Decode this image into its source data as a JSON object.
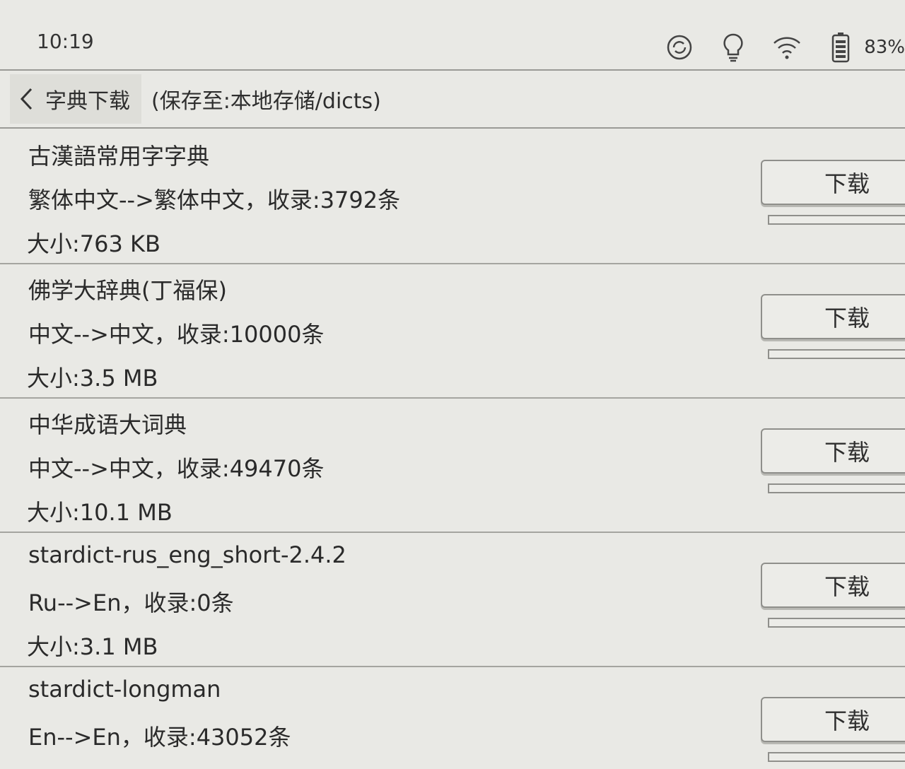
{
  "status_bar": {
    "time": "10:19",
    "battery": "83%"
  },
  "header": {
    "title": "字典下载",
    "subtitle": "(保存至:本地存储/dicts)"
  },
  "download_label": "下载",
  "dictionaries": [
    {
      "name": "古漢語常用字字典",
      "desc": "繁体中文-->繁体中文，收录:3792条",
      "size": "大小:763 KB",
      "button": "下载",
      "progress": 0
    },
    {
      "name": "佛学大辞典(丁福保)",
      "desc": "中文-->中文，收录:10000条",
      "size": "大小:3.5 MB",
      "button": "下载",
      "progress": 0
    },
    {
      "name": "中华成语大词典",
      "desc": "中文-->中文，收录:49470条",
      "size": "大小:10.1 MB",
      "button": "下载",
      "progress": 0
    },
    {
      "name": "stardict-rus_eng_short-2.4.2",
      "desc": "Ru-->En，收录:0条",
      "size": "大小:3.1 MB",
      "button": "下载",
      "progress": 0
    },
    {
      "name": "stardict-longman",
      "desc": "En-->En，收录:43052条",
      "size": "",
      "button": "下载",
      "progress": 0
    }
  ]
}
